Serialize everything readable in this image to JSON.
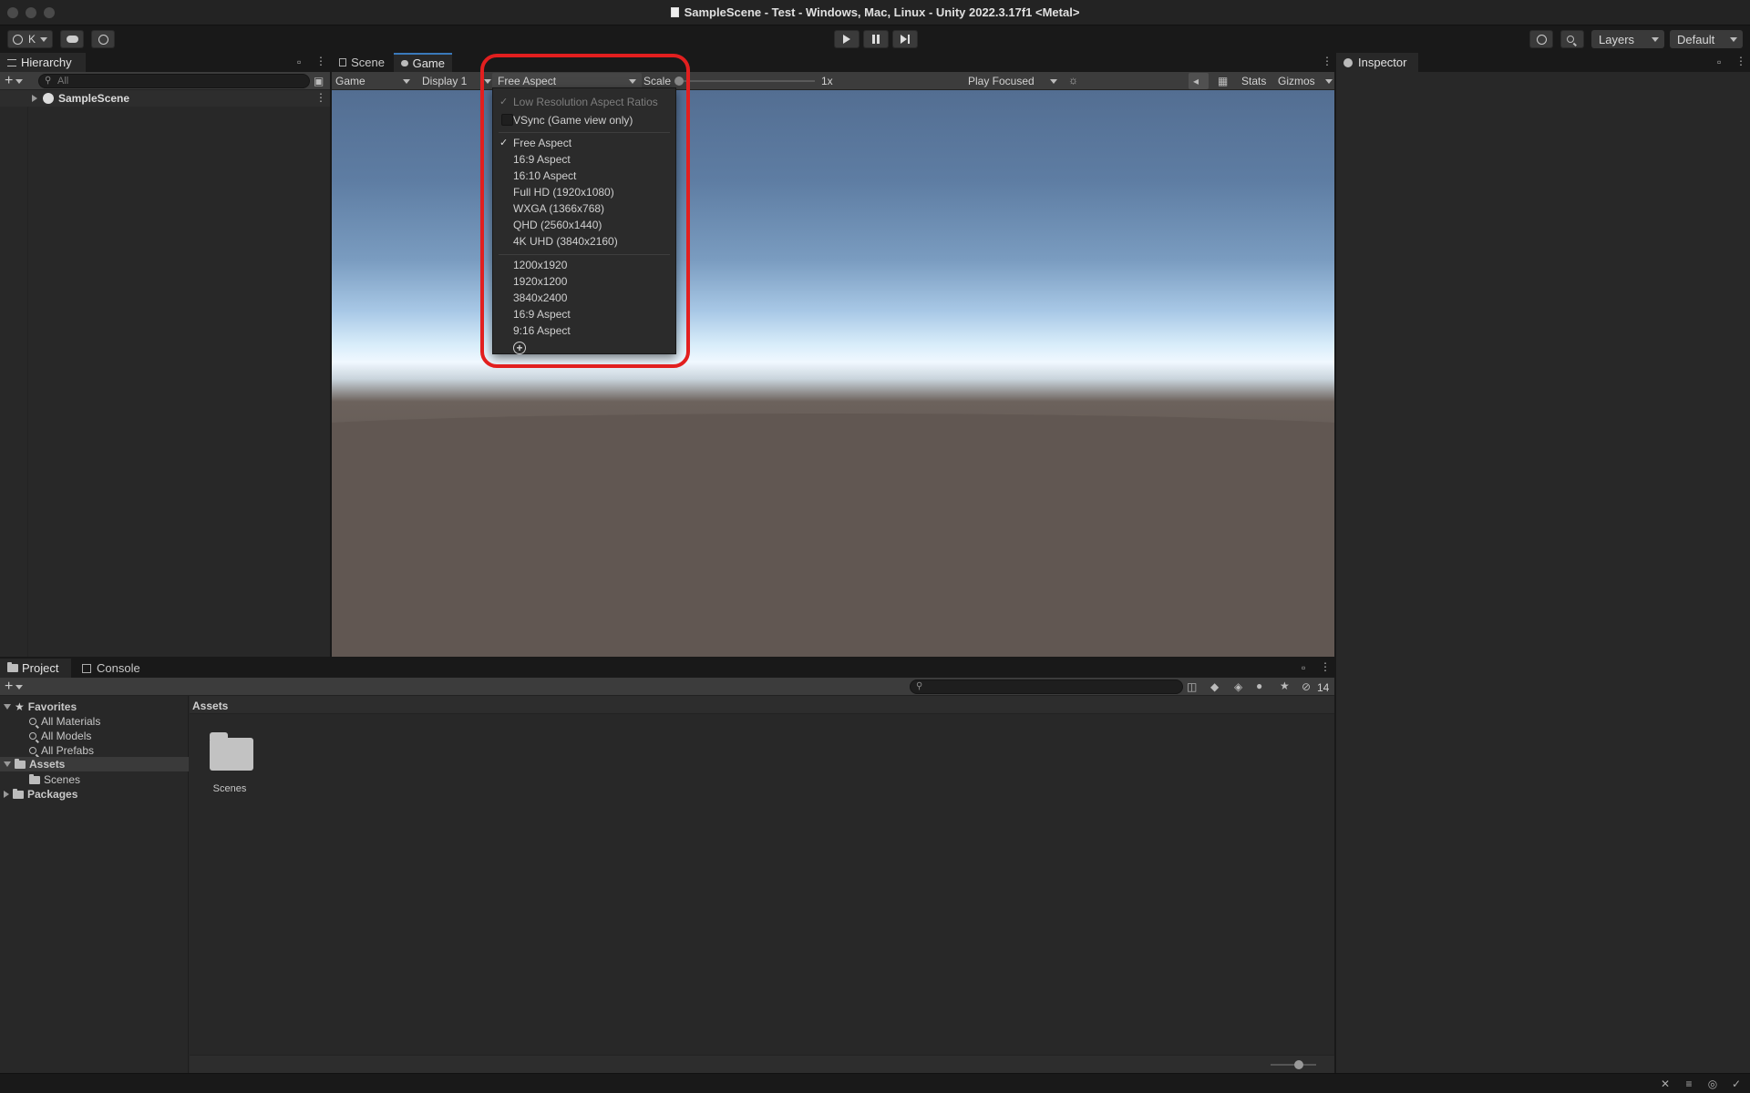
{
  "window": {
    "title": "SampleScene - Test - Windows, Mac, Linux - Unity 2022.3.17f1 <Metal>"
  },
  "toolbar": {
    "account_label": "K",
    "layers_label": "Layers",
    "layout_label": "Default"
  },
  "hierarchy": {
    "tab_label": "Hierarchy",
    "search_placeholder": "All",
    "scene_name": "SampleScene"
  },
  "center_tabs": {
    "scene": "Scene",
    "game": "Game"
  },
  "game_toolbar": {
    "view_mode": "Game",
    "display": "Display 1",
    "aspect": "Free Aspect",
    "scale_label": "Scale",
    "scale_value": "1x",
    "play_mode": "Play Focused",
    "stats": "Stats",
    "gizmos": "Gizmos"
  },
  "aspect_dropdown": {
    "low_res": "Low Resolution Aspect Ratios",
    "vsync": "VSync (Game view only)",
    "builtin": [
      {
        "label": "Free Aspect",
        "checked": true
      },
      {
        "label": "16:9 Aspect",
        "checked": false
      },
      {
        "label": "16:10 Aspect",
        "checked": false
      },
      {
        "label": "Full HD (1920x1080)",
        "checked": false
      },
      {
        "label": "WXGA (1366x768)",
        "checked": false
      },
      {
        "label": "QHD (2560x1440)",
        "checked": false
      },
      {
        "label": "4K UHD (3840x2160)",
        "checked": false
      }
    ],
    "custom": [
      {
        "label": "1200x1920"
      },
      {
        "label": "1920x1200"
      },
      {
        "label": "3840x2400"
      },
      {
        "label": "16:9 Aspect"
      },
      {
        "label": "9:16 Aspect"
      }
    ]
  },
  "inspector": {
    "tab_label": "Inspector"
  },
  "project": {
    "tab_project": "Project",
    "tab_console": "Console",
    "hidden_count": "14",
    "favorites_label": "Favorites",
    "favorites": [
      "All Materials",
      "All Models",
      "All Prefabs"
    ],
    "assets_label": "Assets",
    "assets_children": [
      "Scenes"
    ],
    "packages_label": "Packages",
    "breadcrumb": "Assets",
    "grid_items": [
      {
        "label": "Scenes"
      }
    ]
  },
  "colors": {
    "accent": "#3a79bb",
    "highlight": "#e21f1f",
    "panel": "#282828",
    "background": "#191919"
  }
}
